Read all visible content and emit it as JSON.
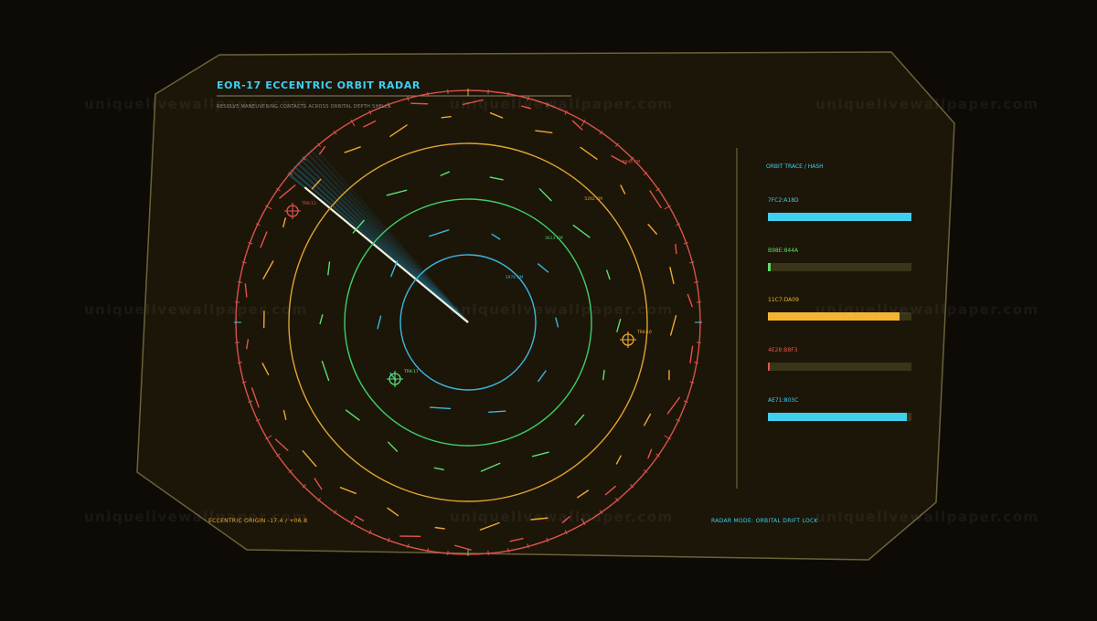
{
  "header": {
    "title": "EOR-17  ECCENTRIC ORBIT RADAR",
    "subtitle": "RESOLVE MANEUVERING CONTACTS ACROSS ORBITAL DEPTH SHELLS"
  },
  "footer": {
    "origin": "ECCENTRIC ORIGIN  -17.4 / +06.8",
    "mode": "RADAR MODE: ORBITAL DRIFT LOCK"
  },
  "watermark": "uniquelivewallpaper.com",
  "rings": [
    {
      "label": "1974 KM",
      "color": "#3ab8e0"
    },
    {
      "label": "3613 KM",
      "color": "#3fcf66"
    },
    {
      "label": "5292 KM",
      "color": "#e2a431"
    },
    {
      "label": "6944 KM",
      "color": "#d9534a"
    }
  ],
  "targets": [
    {
      "label": "TRK-13",
      "color": "#e8504a"
    },
    {
      "label": "TRK-10",
      "color": "#f0a832"
    },
    {
      "label": "TRK-17",
      "color": "#5de071"
    }
  ],
  "trace_panel": {
    "title": "ORBIT TRACE / HASH",
    "bars": [
      {
        "label": "7FC2:A18D",
        "value": 1.0,
        "color": "#3fd0f0"
      },
      {
        "label": "B98E:844A",
        "value": 0.02,
        "color": "#5fdc6a"
      },
      {
        "label": "11C7:DA09",
        "value": 0.92,
        "color": "#f5b42f"
      },
      {
        "label": "4E28:B8F3",
        "value": 0.01,
        "color": "#e2574c"
      },
      {
        "label": "AE71:803C",
        "value": 0.97,
        "color": "#3fd0f0"
      }
    ]
  },
  "colors": {
    "accent": "#3fd0f0",
    "amber": "#f0a832",
    "panel_border": "#6a6238"
  }
}
